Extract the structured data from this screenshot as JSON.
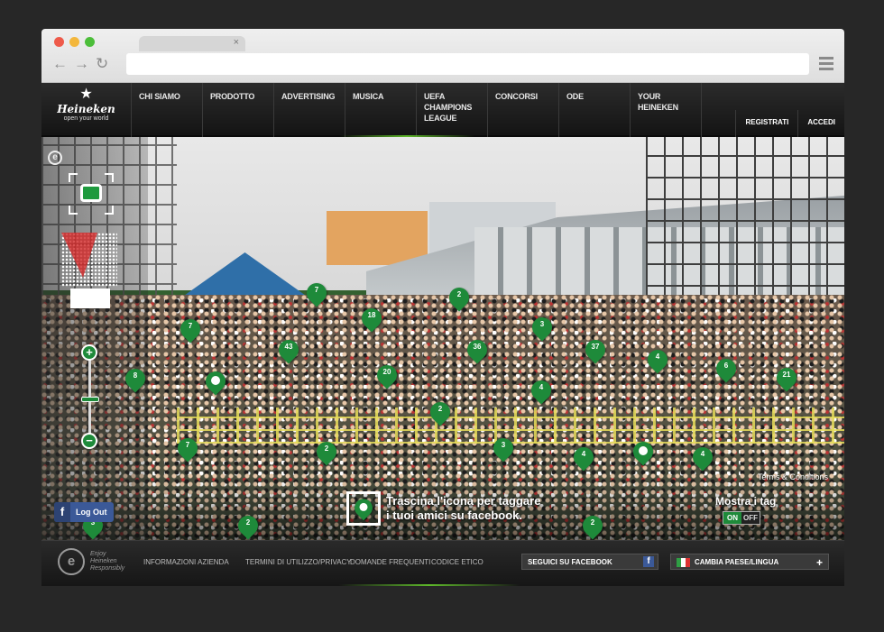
{
  "browser": {
    "tab_close": "×",
    "back": "←",
    "forward": "→",
    "reload": "↻"
  },
  "header": {
    "brand_star": "★",
    "brand_name": "Heineken",
    "brand_tagline": "open your world",
    "menu": [
      "Chi siamo",
      "Prodotto",
      "Advertising",
      "Musica",
      "UEFA Champions League",
      "Concorsi",
      "Ode",
      "Your Heineken"
    ],
    "register": "REGISTRATI",
    "login": "ACCEDI"
  },
  "photo": {
    "e_icon": "e",
    "zoom_in": "+",
    "zoom_out": "−",
    "zoom_level": 0.5,
    "logout_icon": "f",
    "logout": "Log Out",
    "drag_hint_line1": "Trascina l'icona per taggare",
    "drag_hint_line2": "i tuoi amici su facebook.",
    "terms": "Terms & Conditions",
    "show_tags": "Mostra i tag",
    "toggle_on": "ON",
    "toggle_off": "OFF",
    "tags": [
      "7",
      "2",
      "3",
      "7",
      "18",
      "43",
      "36",
      "37",
      "4",
      "6",
      "21",
      "8",
      "20",
      "4",
      "2",
      "7",
      "2",
      "3",
      "4",
      "4",
      "2",
      "2",
      "3",
      "",
      ""
    ]
  },
  "footer": {
    "enjoy_logo": "e",
    "enjoy_text_1": "Enjoy",
    "enjoy_text_2": "Heineken",
    "enjoy_text_3": "Responsibly",
    "links": [
      "INFORMAZIONI AZIENDA",
      "TERMINI DI UTILIZZO/PRIVACY",
      "DOMANDE FREQUENTI",
      "CODICE ETICO"
    ],
    "facebook": "SEGUICI SU FACEBOOK",
    "facebook_icon": "f",
    "lang": "CAMBIA PAESE/LINGUA",
    "lang_plus": "+"
  },
  "colors": {
    "brand_green": "#1e8a3a",
    "facebook_blue": "#3b5998"
  }
}
